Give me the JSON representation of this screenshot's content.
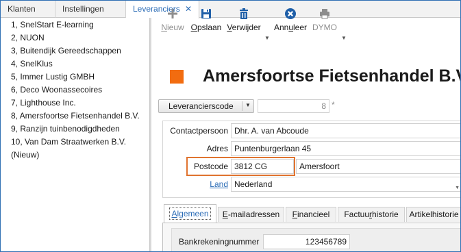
{
  "tabs": [
    {
      "label": "Klanten"
    },
    {
      "label": "Instellingen"
    },
    {
      "label": "Leveranciers",
      "close": "✕"
    }
  ],
  "list": {
    "items": [
      "1, SnelStart E-learning",
      "2, NUON",
      "3, Buitendijk Gereedschappen",
      "4, SnelKlus",
      "5, Immer Lustig GMBH",
      "6, Deco Woonassecoires",
      "7, Lighthouse Inc.",
      "8, Amersfoortse Fietsenhandel B.V.",
      "9, Ranzijn tuinbenodigdheden",
      "10, Van Dam Straatwerken B.V.",
      "(Nieuw)"
    ]
  },
  "toolbar": {
    "new": {
      "first": "N",
      "rest": "ieuw",
      "icon": "plus-icon",
      "color": "#8e8e8e"
    },
    "save": {
      "first": "O",
      "rest": "pslaan",
      "icon": "save-icon",
      "color": "#1f5fa8"
    },
    "delete": {
      "first": "V",
      "rest": "erwijder",
      "icon": "trash-icon",
      "color": "#1f5fa8"
    },
    "cancel": {
      "pre": "Ann",
      "u": "u",
      "post": "leer",
      "icon": "cancel-icon",
      "color": "#1f5fa8"
    },
    "dymo": {
      "label": "DYMO",
      "icon": "printer-icon",
      "color": "#8e8e8e"
    }
  },
  "header": {
    "title": "Amersfoortse Fietsenhandel B.V.",
    "accent": "#f26c10"
  },
  "code": {
    "label": "Leverancierscode",
    "value": "8",
    "required": "*"
  },
  "address": {
    "contact_label": "Contactpersoon",
    "contact_value": "Dhr. A. van Abcoude",
    "address_label": "Adres",
    "address_value": "Puntenburgerlaan 45",
    "postcode_label": "Postcode",
    "postcode_value": "3812 CG",
    "city_value": "Amersfoort",
    "country_label": "Land",
    "country_value": "Nederland",
    "highlight_color": "#e0732f"
  },
  "bottom_tabs": [
    {
      "pre": "",
      "u": "A",
      "post": "lgemeen"
    },
    {
      "pre": "",
      "u": "E",
      "post": "-mailadressen"
    },
    {
      "pre": "",
      "u": "F",
      "post": "inancieel"
    },
    {
      "pre": "Factuu",
      "u": "r",
      "post": "historie"
    },
    {
      "pre": "Artikelhistorie",
      "u": "",
      "post": ""
    }
  ],
  "bank": {
    "label": "Bankrekeningnummer",
    "value": "123456789"
  }
}
